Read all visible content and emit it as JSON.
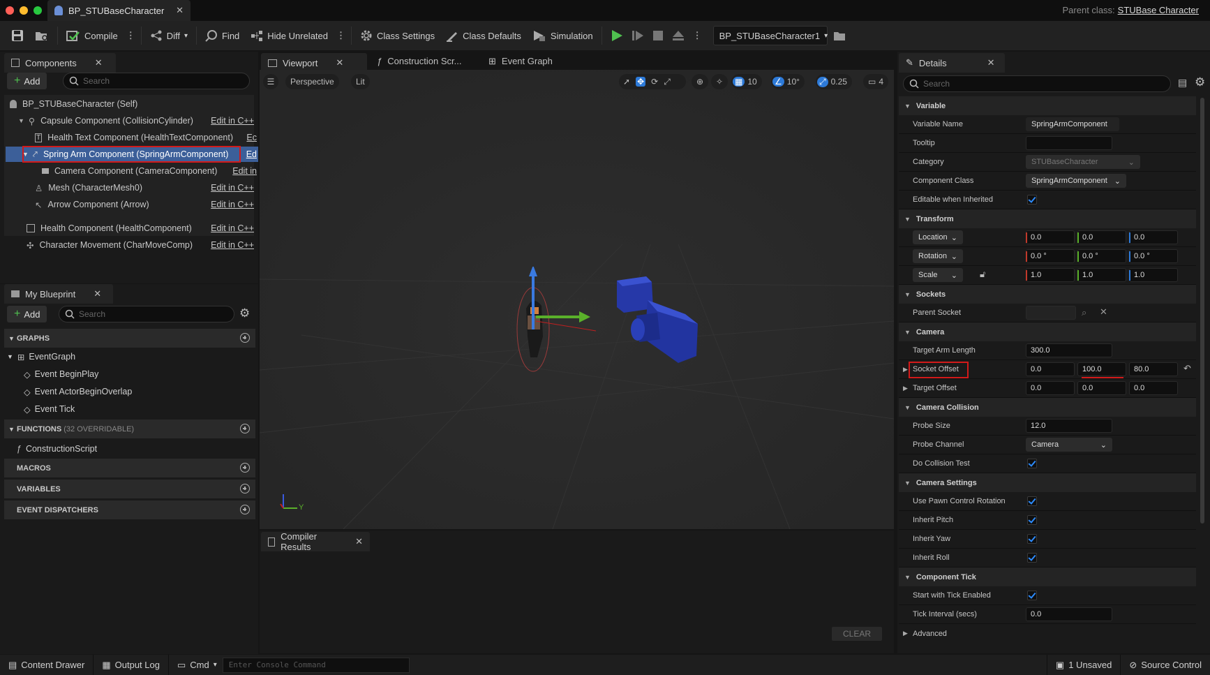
{
  "title_tab": "BP_STUBaseCharacter",
  "parent_class": {
    "label": "Parent class:",
    "value": "STUBase Character"
  },
  "toolbar": {
    "compile": "Compile",
    "diff": "Diff",
    "find": "Find",
    "hide_unrelated": "Hide Unrelated",
    "class_settings": "Class Settings",
    "class_defaults": "Class Defaults",
    "simulation": "Simulation",
    "debug_object": "BP_STUBaseCharacter1"
  },
  "components": {
    "tab": "Components",
    "add": "Add",
    "search_placeholder": "Search",
    "root": "BP_STUBaseCharacter (Self)",
    "edit_label": "Edit in C++",
    "items": [
      "Capsule Component (CollisionCylinder)",
      "Health Text Component (HealthTextComponent)",
      "Spring Arm Component (SpringArmComponent)",
      "Camera Component (CameraComponent)",
      "Mesh (CharacterMesh0)",
      "Arrow Component (Arrow)",
      "Health Component (HealthComponent)",
      "Character Movement (CharMoveComp)"
    ],
    "edit_short_1": "Ec",
    "edit_short_2": "Ed",
    "edit_short_3": "Edit in"
  },
  "my_blueprint": {
    "tab": "My Blueprint",
    "add": "Add",
    "search_placeholder": "Search",
    "graphs": "GRAPHS",
    "event_graph": "EventGraph",
    "events": [
      "Event BeginPlay",
      "Event ActorBeginOverlap",
      "Event Tick"
    ],
    "functions": "FUNCTIONS",
    "functions_count": "(32 OVERRIDABLE)",
    "construction": "ConstructionScript",
    "macros": "MACROS",
    "variables": "VARIABLES",
    "dispatchers": "EVENT DISPATCHERS"
  },
  "center_tabs": {
    "viewport": "Viewport",
    "construction": "Construction Scr...",
    "event_graph": "Event Graph"
  },
  "viewport": {
    "perspective": "Perspective",
    "lit": "Lit",
    "grid": "10",
    "angle": "10°",
    "scale": "0.25",
    "camera_speed": "4",
    "axis_y": "Y"
  },
  "compiler": {
    "tab": "Compiler Results",
    "clear": "CLEAR"
  },
  "details": {
    "tab": "Details",
    "search_placeholder": "Search",
    "variable": {
      "section": "Variable",
      "name_label": "Variable Name",
      "name_value": "SpringArmComponent",
      "tooltip_label": "Tooltip",
      "category_label": "Category",
      "category_value": "STUBaseCharacter",
      "class_label": "Component Class",
      "class_value": "SpringArmComponent",
      "editable_label": "Editable when Inherited"
    },
    "transform": {
      "section": "Transform",
      "location": "Location",
      "rotation": "Rotation",
      "scale": "Scale",
      "loc": [
        "0.0",
        "0.0",
        "0.0"
      ],
      "rot": [
        "0.0 °",
        "0.0 °",
        "0.0 °"
      ],
      "scl": [
        "1.0",
        "1.0",
        "1.0"
      ]
    },
    "sockets": {
      "section": "Sockets",
      "parent_label": "Parent Socket"
    },
    "camera": {
      "section": "Camera",
      "arm_label": "Target Arm Length",
      "arm_value": "300.0",
      "socket_label": "Socket Offset",
      "socket": [
        "0.0",
        "100.0",
        "80.0"
      ],
      "target_label": "Target Offset",
      "target": [
        "0.0",
        "0.0",
        "0.0"
      ]
    },
    "collision": {
      "section": "Camera Collision",
      "probe_size_label": "Probe Size",
      "probe_size": "12.0",
      "channel_label": "Probe Channel",
      "channel": "Camera",
      "do_test_label": "Do Collision Test"
    },
    "settings": {
      "section": "Camera Settings",
      "items": [
        "Use Pawn Control Rotation",
        "Inherit Pitch",
        "Inherit Yaw",
        "Inherit Roll"
      ]
    },
    "tick": {
      "section": "Component Tick",
      "start_label": "Start with Tick Enabled",
      "interval_label": "Tick Interval (secs)",
      "interval": "0.0"
    },
    "advanced": "Advanced"
  },
  "status": {
    "content_drawer": "Content Drawer",
    "output_log": "Output Log",
    "cmd": "Cmd",
    "console_placeholder": "Enter Console Command",
    "unsaved": "1 Unsaved",
    "source_control": "Source Control"
  }
}
